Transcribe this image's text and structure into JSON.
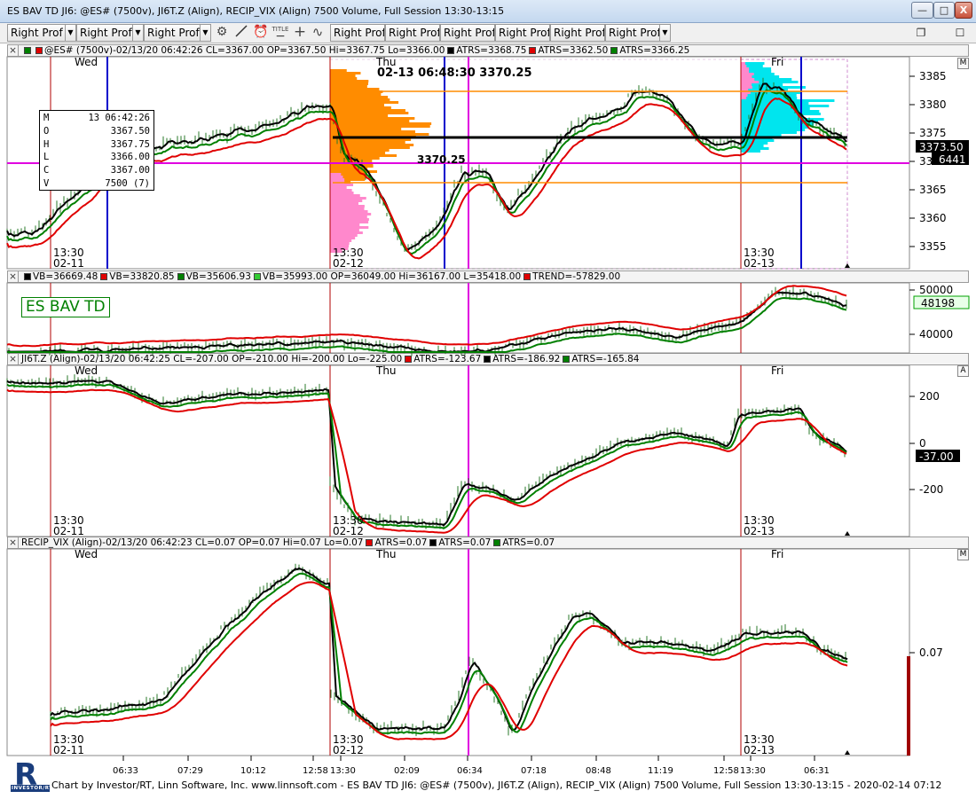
{
  "window": {
    "title": "ES BAV TD JI6: @ES# (7500v), JI6T.Z (Align), RECIP_VIX (Align) 7500 Volume, Full Session 13:30-13:15",
    "minimize": "—",
    "maximize": "□",
    "close": "X"
  },
  "toolbar": {
    "buttons": [
      "Right Prof",
      "Right Prof",
      "Right Prof",
      "Right Prof",
      "Right Prof",
      "Right Prof",
      "Right Prof",
      "Right Prof",
      "Right Prof"
    ],
    "drop": "▼",
    "icons": [
      "gear-icon",
      "line-tool-icon",
      "alarm-clock-icon",
      "title-icon",
      "crosshair-icon",
      "cycle-icon"
    ],
    "title_icon_text": "TITLE",
    "restore": "❐",
    "maximize": "☐"
  },
  "pane1": {
    "header": {
      "symbol": "@ES# (7500v)-02/13/20 06:42:26 CL=3367.00 OP=3367.50 Hi=3367.75 Lo=3366.00",
      "atrs": [
        "ATRS=3368.75",
        "ATRS=3362.50",
        "ATRS=3366.25"
      ]
    },
    "scale_mode": "M",
    "day_labels": [
      "Wed",
      "Thu",
      "Fri"
    ],
    "session_labels": [
      {
        "time": "13:30",
        "date": "02-11"
      },
      {
        "time": "13:30",
        "date": "02-12"
      },
      {
        "time": "13:30",
        "date": "02-13"
      }
    ],
    "y_ticks": [
      "3385",
      "3380",
      "3375",
      "3370",
      "3365",
      "3360",
      "3355"
    ],
    "price_tag": "3373.50",
    "volume_tag": "6441",
    "annotation_top": "02-13 06:48:30  3370.25",
    "annotation_mid": "3370.25",
    "cursor": {
      "rows": [
        {
          "k": "M",
          "v": "13 06:42:26"
        },
        {
          "k": "O",
          "v": "3367.50"
        },
        {
          "k": "H",
          "v": "3367.75"
        },
        {
          "k": "L",
          "v": "3366.00"
        },
        {
          "k": "C",
          "v": "3367.00"
        },
        {
          "k": "V",
          "v": "7500 (7)"
        }
      ]
    }
  },
  "pane2": {
    "header": {
      "items": [
        "VB=36669.48",
        "VB=33820.85",
        "VB=35606.93",
        "VB=35993.00 OP=36049.00 Hi=36167.00 L=35418.00",
        "TREND=-57829.00"
      ]
    },
    "study_label": "ES BAV TD",
    "y_ticks": [
      "50000",
      "40000"
    ],
    "value_tag": "48198"
  },
  "pane3": {
    "header": {
      "symbol": "JI6T.Z (Align)-02/13/20 06:42:25 CL=-207.00 OP=-210.00 Hi=-200.00 Lo=-225.00",
      "atrs": [
        "ATRS=-123.67",
        "ATRS=-186.92",
        "ATRS=-165.84"
      ]
    },
    "scale_mode": "A",
    "day_labels": [
      "Wed",
      "Thu",
      "Fri"
    ],
    "session_labels": [
      {
        "time": "13:30",
        "date": "02-11"
      },
      {
        "time": "13:30",
        "date": "02-12"
      },
      {
        "time": "13:30",
        "date": "02-13"
      }
    ],
    "y_ticks": [
      "200",
      "0",
      "-200"
    ],
    "value_tag": "-37.00"
  },
  "pane4": {
    "header": {
      "symbol": "RECIP_VIX (Align)-02/13/20 06:42:23 CL=0.07 OP=0.07 Hi=0.07 Lo=0.07",
      "atrs": [
        "ATRS=0.07",
        "ATRS=0.07",
        "ATRS=0.07"
      ]
    },
    "scale_mode": "M",
    "day_labels": [
      "Wed",
      "Thu",
      "Fri"
    ],
    "session_labels": [
      {
        "time": "13:30",
        "date": "02-11"
      },
      {
        "time": "13:30",
        "date": "02-12"
      },
      {
        "time": "13:30",
        "date": "02-13"
      }
    ],
    "y_ticks": [
      "0.07"
    ]
  },
  "x_axis": {
    "ticks": [
      "06:33",
      "07:29",
      "10:12",
      "12:58",
      "13:30",
      "02:09",
      "06:34",
      "07:18",
      "08:48",
      "11:19",
      "12:58",
      "13:30",
      "06:31"
    ]
  },
  "footer": {
    "text": "Chart by Investor/RT, Linn Software, Inc. www.linnsoft.com - ES BAV TD JI6: @ES# (7500v), JI6T.Z (Align), RECIP_VIX (Align) 7500 Volume, Full Session 13:30-13:15 - 2020-02-14 07:12",
    "logo_text": "INVESTOR/RT"
  },
  "colors": {
    "red_line": "#e00000",
    "black_line": "#000000",
    "green_line": "#008000",
    "magenta": "#e000e0",
    "blue": "#0000cc",
    "orange": "#ff8c00",
    "pink": "#ff88cc",
    "cyan": "#00e5ee",
    "session_line": "#b00000"
  }
}
